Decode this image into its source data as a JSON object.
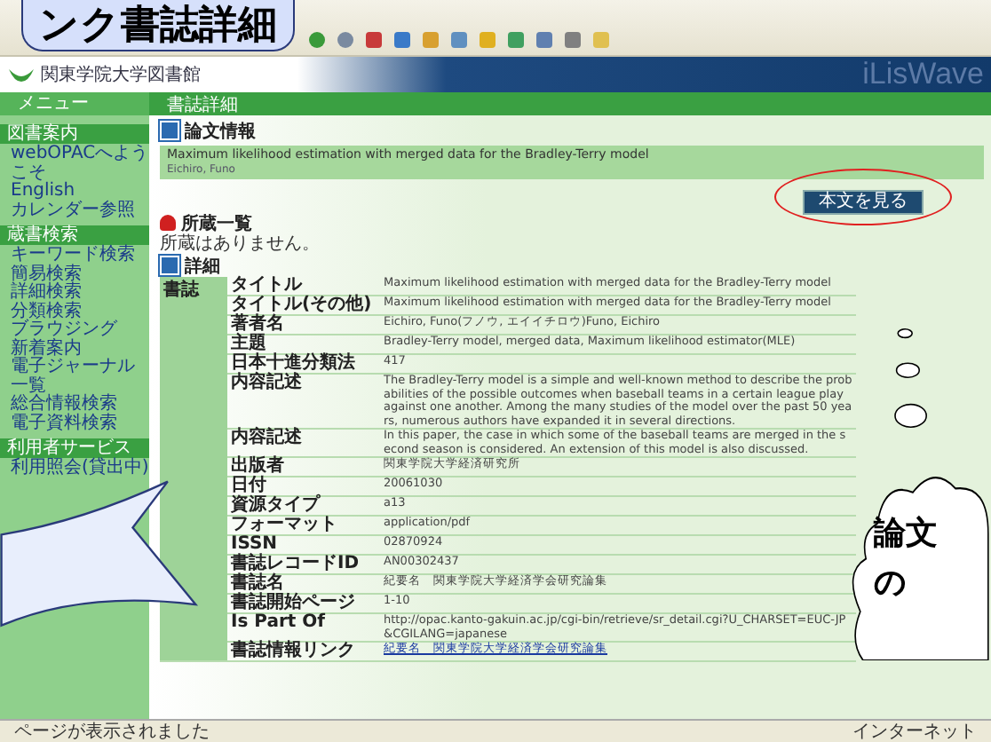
{
  "slide_title": "ンク書誌詳細",
  "site": {
    "name": "関東学院大学図書館",
    "brand": "iLisWave"
  },
  "section_bar": {
    "menu": "メニュー",
    "title": "書誌詳細"
  },
  "sidebar": [
    {
      "header": "図書案内",
      "items": [
        "webOPACへようこそ",
        "English",
        "カレンダー参照"
      ]
    },
    {
      "header": "蔵書検索",
      "items": [
        "キーワード検索",
        "簡易検索",
        "詳細検索",
        "分類検索",
        "ブラウジング",
        "新着案内",
        "電子ジャーナル一覧",
        "総合情報検索",
        "電子資料検索"
      ]
    },
    {
      "header": "利用者サービス",
      "items": [
        "利用照会(貸出中)"
      ]
    }
  ],
  "record": {
    "heading": "論文情報",
    "title": "Maximum likelihood estimation with merged data for the Bradley-Terry model",
    "author": "Eichiro, Funo",
    "fulltext_button": "本文を見る"
  },
  "holdings": {
    "heading": "所蔵一覧",
    "message": "所蔵はありません。"
  },
  "details": {
    "heading": "詳細",
    "group": "書誌",
    "rows": [
      {
        "label": "タイトル",
        "value": "Maximum likelihood estimation with merged data for the Bradley-Terry model"
      },
      {
        "label": "タイトル(その他)",
        "value": "Maximum likelihood estimation with merged data for the Bradley-Terry model"
      },
      {
        "label": "著者名",
        "value": "Eichiro, Funo(フノウ, エイイチロウ)Funo, Eichiro"
      },
      {
        "label": "主題",
        "value": "Bradley-Terry model, merged data, Maximum likelihood estimator(MLE)"
      },
      {
        "label": "日本十進分類法",
        "value": "417"
      },
      {
        "label": "内容記述",
        "value": "The Bradley-Terry model is a simple and well-known method to describe the probabilities of the possible outcomes when baseball teams in a certain league play against one another. Among the many studies of the model over the past 50 years, numerous authors have expanded it in several directions."
      },
      {
        "label": "内容記述",
        "value": "In this paper, the case in which some of the baseball teams are merged in the second season is considered. An extension of this model is also discussed."
      },
      {
        "label": "出版者",
        "value": "関東学院大学経済研究所"
      },
      {
        "label": "日付",
        "value": "20061030"
      },
      {
        "label": "資源タイプ",
        "value": "a13"
      },
      {
        "label": "フォーマット",
        "value": "application/pdf"
      },
      {
        "label": "ISSN",
        "value": "02870924"
      },
      {
        "label": "書誌レコードID",
        "value": "AN00302437"
      },
      {
        "label": "書誌名",
        "value": "紀要名　関東学院大学経済学会研究論集"
      },
      {
        "label": "書誌開始ページ",
        "value": "1-10"
      },
      {
        "label": "Is Part Of",
        "value": "http://opac.kanto-gakuin.ac.jp/cgi-bin/retrieve/sr_detail.cgi?U_CHARSET=EUC-JP&CGILANG=japanese"
      },
      {
        "label": "書誌情報リンク",
        "value": "紀要名　関東学院大学経済学会研究論集",
        "kind": "link"
      }
    ]
  },
  "cloud": [
    "論文",
    "の"
  ],
  "status_bar": {
    "message": "ページが表示されました",
    "zone": "インターネット"
  }
}
